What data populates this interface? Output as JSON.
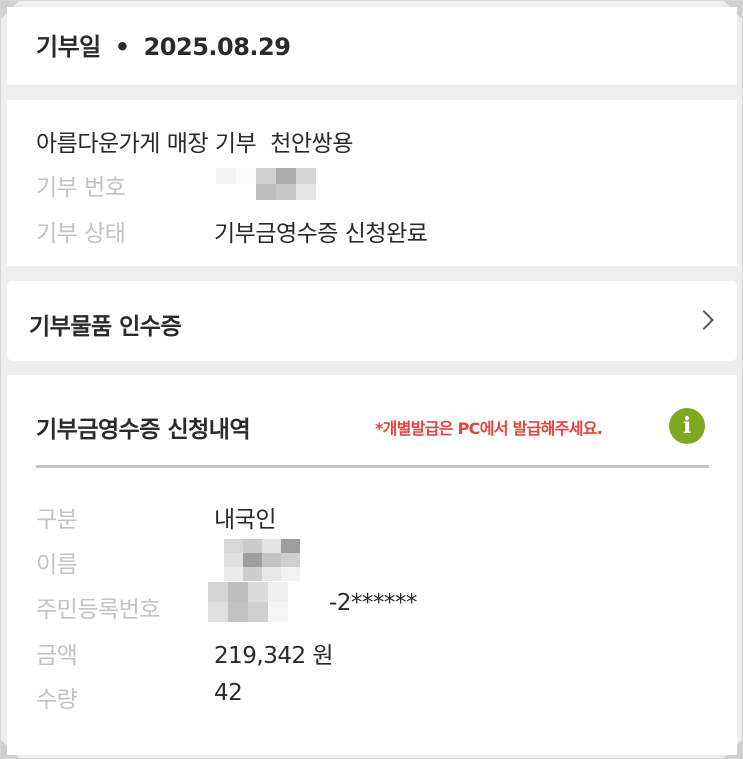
{
  "donation_date": {
    "label": "기부일",
    "separator": "•",
    "value": "2025.08.29"
  },
  "donation_info": {
    "program": "아름다운가게 매장 기부",
    "store": "천안쌍용",
    "number_label": "기부 번호",
    "status_label": "기부 상태",
    "status_value": "기부금영수증 신청완료"
  },
  "receipt_link": {
    "label": "기부물품 인수증",
    "icon": "chevron-right-icon"
  },
  "request": {
    "title": "기부금영수증 신청내역",
    "notice": "*개별발급은 PC에서 발급해주세요.",
    "info_icon_glyph": "i",
    "info_icon_color": "#7ea81e",
    "notice_color": "#e0463f",
    "fields": {
      "category_label": "구분",
      "category_value": "내국인",
      "name_label": "이름",
      "resident_label": "주민등록번호",
      "resident_suffix": "-2******",
      "amount_label": "금액",
      "amount_value": "219,342 원",
      "quantity_label": "수량",
      "quantity_value": "42"
    }
  }
}
